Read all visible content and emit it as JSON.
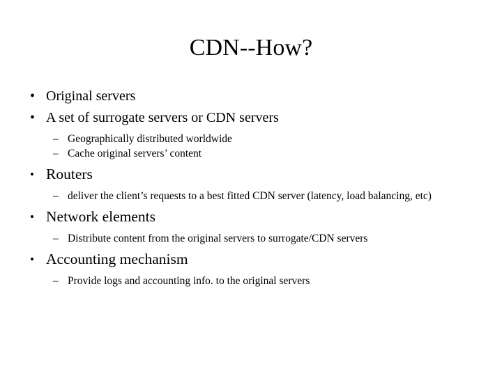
{
  "slide": {
    "title": "CDN--How?",
    "background_color": "#ffffff",
    "text_color": "#000000",
    "bullet_marker_level1": "•",
    "bullet_marker_level2": "–",
    "items": [
      {
        "level": 1,
        "text": "Original servers"
      },
      {
        "level": 1,
        "text": "A set of surrogate servers or CDN servers"
      },
      {
        "level": 2,
        "text": "Geographically distributed worldwide"
      },
      {
        "level": 2,
        "text": "Cache original servers’ content"
      },
      {
        "level": 1,
        "text": "Routers"
      },
      {
        "level": 2,
        "text": "deliver the client’s requests to a best fitted CDN server (latency, load balancing, etc)"
      },
      {
        "level": 1,
        "text": "Network elements"
      },
      {
        "level": 2,
        "text": "Distribute content from the original servers to surrogate/CDN servers"
      },
      {
        "level": 1,
        "text": "Accounting mechanism"
      },
      {
        "level": 2,
        "text": "Provide logs and accounting info. to the original servers"
      }
    ]
  }
}
